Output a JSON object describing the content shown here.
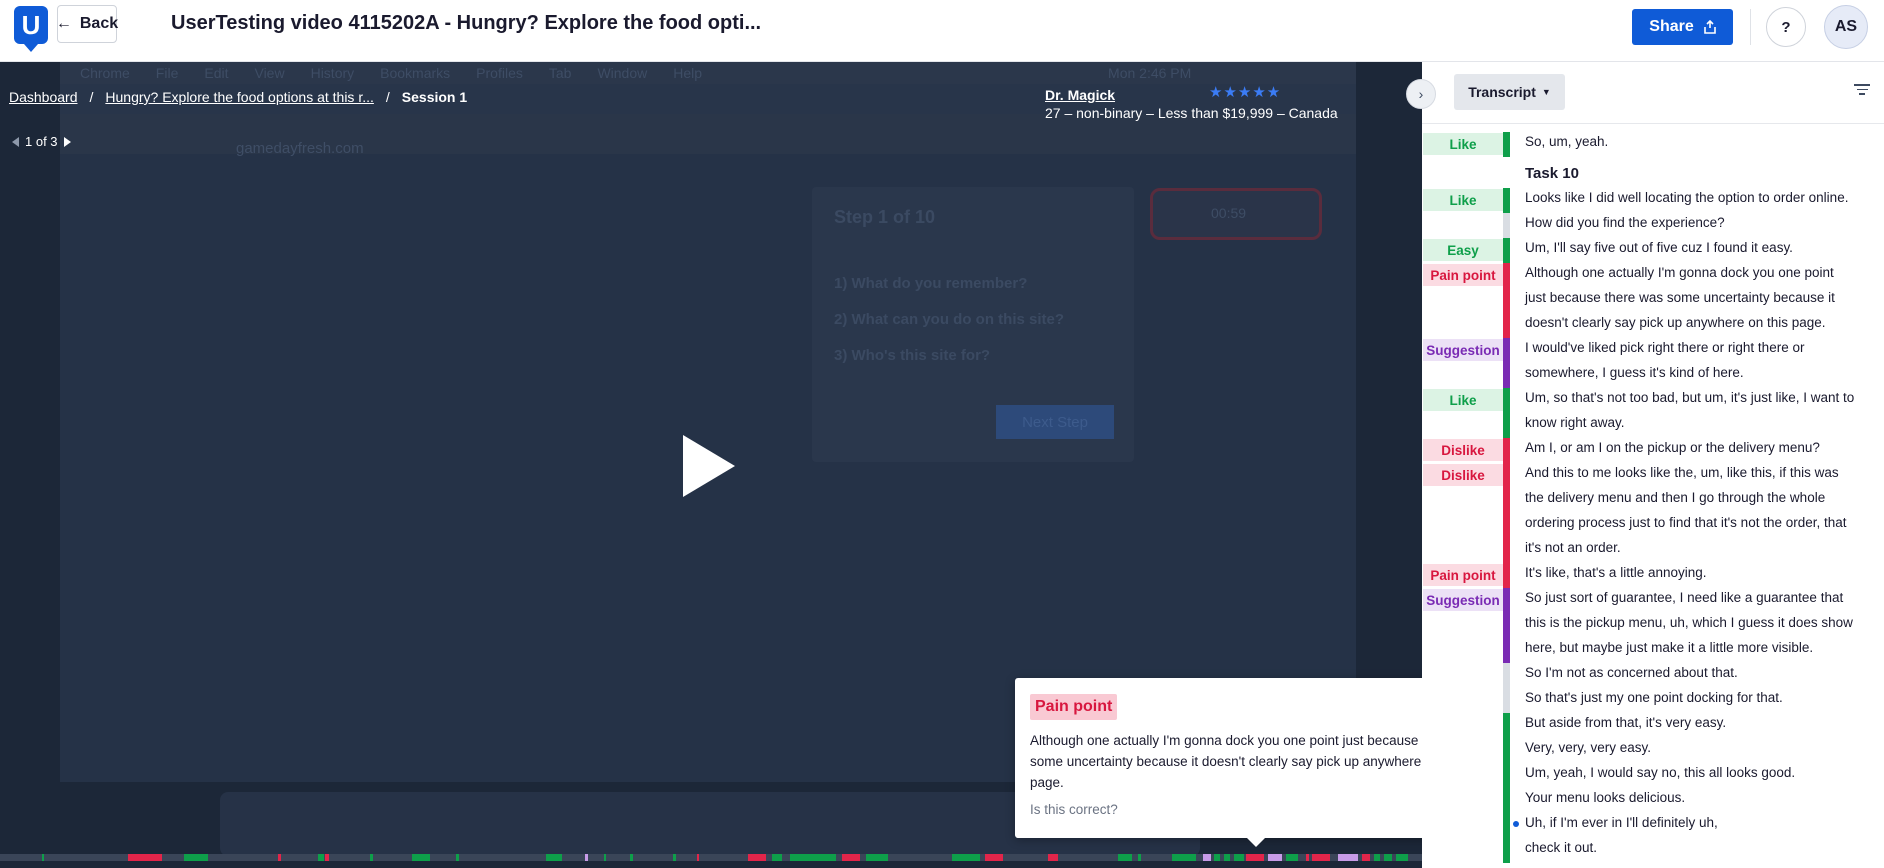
{
  "header": {
    "logo_letter": "U",
    "back_label": "Back",
    "title": "UserTesting video 4115202A - Hungry? Explore the food opti...",
    "share_label": "Share",
    "help_label": "?",
    "avatar_initials": "AS"
  },
  "breadcrumb": {
    "dashboard": "Dashboard",
    "sep1": "/",
    "test": "Hungry? Explore the food options at this r...",
    "sep2": "/",
    "session": "Session 1"
  },
  "pager": {
    "label": "1 of 3"
  },
  "tester": {
    "name": "Dr. Magick",
    "stars": "★★★★★",
    "demographics": "27 – non-binary – Less than $19,999 – Canada"
  },
  "video_bg": {
    "menu": [
      "Chrome",
      "File",
      "Edit",
      "View",
      "History",
      "Bookmarks",
      "Profiles",
      "Tab",
      "Window",
      "Help"
    ],
    "clock": "Mon 2:46 PM",
    "url": "gamedayfresh.com",
    "step_title": "Step 1 of 10",
    "questions": [
      "1) What do you remember?",
      "2) What can you do on this site?",
      "3) Who's this site for?"
    ],
    "next_step": "Next Step",
    "timer": "00:59"
  },
  "popup": {
    "badge": "Pain point",
    "body": "Although one actually I'm gonna dock you one point just because there was some uncertainty because it doesn't clearly say pick up anywhere on this page.",
    "question": "Is this correct?",
    "confirm_icon": "✓",
    "dismiss_icon": "✕"
  },
  "panel": {
    "tab_label": "Transcript",
    "collapse_icon": "›",
    "rows": [
      {
        "tag": "Like",
        "tagclass": "like",
        "bar": "g",
        "lines": [
          "So, um, yeah."
        ]
      },
      {
        "tag": "",
        "tagclass": "",
        "bar": "",
        "lines": [
          "Task 10"
        ],
        "task": true
      },
      {
        "tag": "Like",
        "tagclass": "like",
        "bar": "g",
        "lines": [
          "Looks like I did well locating the option to order online."
        ]
      },
      {
        "tag": "",
        "tagclass": "",
        "bar": "grey",
        "lines": [
          "How did you find the experience?"
        ]
      },
      {
        "tag": "Easy",
        "tagclass": "easy",
        "bar": "g",
        "lines": [
          "Um, I'll say five out of five cuz I found it easy."
        ]
      },
      {
        "tag": "Pain point",
        "tagclass": "pain",
        "bar": "r",
        "lines": [
          "Although one actually I'm gonna dock you one point",
          "just because there was some uncertainty because it",
          "doesn't clearly say pick up anywhere on this page."
        ]
      },
      {
        "tag": "Suggestion",
        "tagclass": "sugg",
        "bar": "p",
        "lines": [
          "I would've liked pick right there or right there or",
          "somewhere, I guess it's kind of here."
        ]
      },
      {
        "tag": "Like",
        "tagclass": "like",
        "bar": "g",
        "lines": [
          "Um, so that's not too bad, but um, it's just like, I want to",
          "know right away."
        ]
      },
      {
        "tag": "Dislike",
        "tagclass": "dislike",
        "bar": "r",
        "lines": [
          "Am I, or am I on the pickup or the delivery menu?"
        ]
      },
      {
        "tag": "Dislike",
        "tagclass": "dislike",
        "bar": "r",
        "lines": [
          "And this to me looks like the, um, like this, if this was",
          "the delivery menu and then I go through the whole",
          "ordering process just to find that it's not the order, that",
          "it's not an order."
        ]
      },
      {
        "tag": "Pain point",
        "tagclass": "pain",
        "bar": "r",
        "lines": [
          "It's like, that's a little annoying."
        ]
      },
      {
        "tag": "Suggestion",
        "tagclass": "sugg",
        "bar": "p",
        "lines": [
          "So just sort of guarantee, I need like a guarantee that",
          "this is the pickup menu, uh, which I guess it does show",
          "here, but maybe just make it a little more visible."
        ]
      },
      {
        "tag": "",
        "tagclass": "",
        "bar": "grey",
        "lines": [
          "So I'm not as concerned about that."
        ]
      },
      {
        "tag": "",
        "tagclass": "",
        "bar": "grey",
        "lines": [
          "So that's just my one point docking for that."
        ]
      },
      {
        "tag": "",
        "tagclass": "",
        "bar": "g",
        "lines": [
          "But aside from that, it's very easy."
        ]
      },
      {
        "tag": "",
        "tagclass": "",
        "bar": "g",
        "lines": [
          "Very, very, very easy."
        ]
      },
      {
        "tag": "",
        "tagclass": "",
        "bar": "g",
        "lines": [
          "Um, yeah, I would say no, this all looks good."
        ]
      },
      {
        "tag": "",
        "tagclass": "",
        "bar": "g",
        "lines": [
          "Your menu looks delicious."
        ]
      },
      {
        "tag": "",
        "tagclass": "",
        "bar": "g",
        "lines": [
          "Uh, if I'm ever in                              I'll definitely uh,",
          "check it out."
        ],
        "dot": true
      }
    ]
  },
  "colors": {
    "brand": "#0f5bd7",
    "like": "#0e9f4a",
    "pain": "#e2254a",
    "suggestion": "#7a2bb4",
    "suggestion_light": "#c89be8"
  }
}
